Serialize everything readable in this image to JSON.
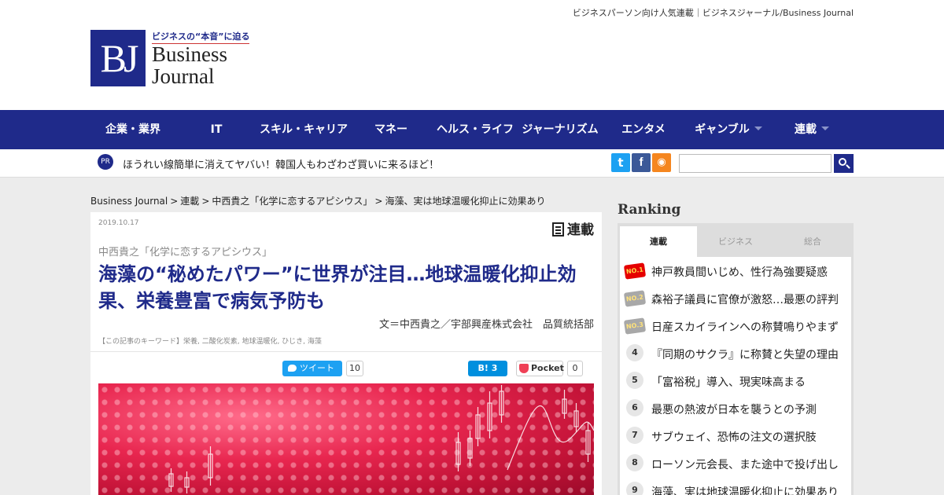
{
  "header": {
    "tagline": "ビジネスパーソン向け人気連載｜ビジネスジャーナル/Business Journal",
    "logo_mark": "BJ",
    "logo_catch": "ビジネスの“本音”に迫る",
    "logo_word1": "Business",
    "logo_word2": "Journal"
  },
  "nav": {
    "items": [
      {
        "label": "企業・業界"
      },
      {
        "label": "IT"
      },
      {
        "label": "スキル・キャリア"
      },
      {
        "label": "マネー"
      },
      {
        "label": "ヘルス・ライフ"
      },
      {
        "label": "ジャーナリズム"
      },
      {
        "label": "エンタメ"
      },
      {
        "label": "ギャンブル"
      },
      {
        "label": "連載"
      }
    ]
  },
  "pr": {
    "badge": "PR",
    "text": "ほうれい線簡単に消えてヤバい！韓国人もわざわざ買いに来るほど！"
  },
  "social": {
    "twitter": "t",
    "facebook": "f",
    "rss": "◉"
  },
  "search": {
    "value": "",
    "placeholder": ""
  },
  "breadcrumb": {
    "items": [
      "Business Journal",
      "連載",
      "中西貴之「化学に恋するアピシウス」",
      "海藻、実は地球温暖化抑止に効果あり"
    ],
    "sep": ">"
  },
  "article": {
    "date": "2019.10.17",
    "section_badge": "連載",
    "series": "中西貴之「化学に恋するアピシウス」",
    "title": "海藻の“秘めたパワー”に世界が注目…地球温暖化抑止効果、栄養豊富で病気予防も",
    "byline": "文＝中西貴之／宇部興産株式会社　品質統括部",
    "keywords": "【この記事のキーワード】栄養, 二酸化炭素, 地球温暖化, ひじき, 海藻",
    "share": {
      "tweet_label": "ツイート",
      "tweet_count": "10",
      "hatena_label": "B! 3",
      "pocket_label": "Pocket",
      "pocket_count": "0"
    }
  },
  "ranking": {
    "title": "Ranking",
    "tabs": [
      "連載",
      "ビジネス",
      "総合"
    ],
    "active_tab": "連載",
    "items": [
      {
        "rank": "NO.1",
        "text": "神戸教員間いじめ、性行為強要疑惑"
      },
      {
        "rank": "NO.2",
        "text": "森裕子議員に官僚が激怒…最悪の評判"
      },
      {
        "rank": "NO.3",
        "text": "日産スカイラインへの称賛鳴りやまず"
      },
      {
        "rank": "4",
        "text": "『同期のサクラ』に称賛と失望の理由"
      },
      {
        "rank": "5",
        "text": "「富裕税」導入、現実味高まる"
      },
      {
        "rank": "6",
        "text": "最悪の熱波が日本を襲うとの予測"
      },
      {
        "rank": "7",
        "text": "サブウェイ、恐怖の注文の選択肢"
      },
      {
        "rank": "8",
        "text": "ローソン元会長、また途中で投げ出し"
      },
      {
        "rank": "9",
        "text": "海藻、実は地球温暖化抑止に効果あり"
      }
    ]
  },
  "colors": {
    "brand": "#1f2a8a",
    "twitter": "#1da1f2",
    "facebook": "#3b5998",
    "rss": "#f5861f",
    "hatena": "#008fde",
    "pocket": "#ef4056"
  }
}
